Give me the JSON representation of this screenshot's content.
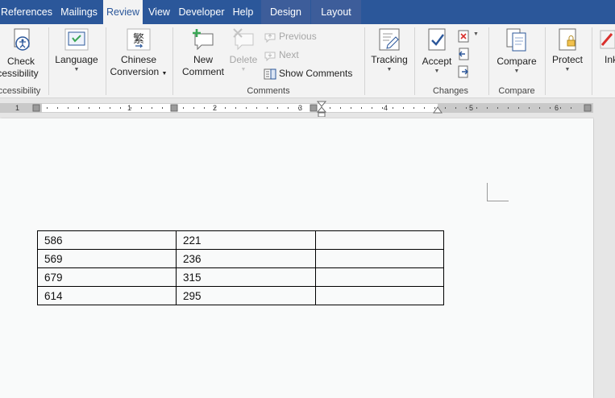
{
  "tabs": [
    {
      "label": "References",
      "active": false
    },
    {
      "label": "Mailings",
      "active": false
    },
    {
      "label": "Review",
      "active": true
    },
    {
      "label": "View",
      "active": false
    },
    {
      "label": "Developer",
      "active": false
    },
    {
      "label": "Help",
      "active": false
    },
    {
      "label": "Design",
      "active": false,
      "contextual": true
    },
    {
      "label": "Layout",
      "active": false,
      "contextual": true
    }
  ],
  "ribbon": {
    "accessibility": {
      "button_line1": "Check",
      "button_line2": "ccessibility",
      "group": "ccessibility"
    },
    "language": {
      "button": "Language"
    },
    "chinese": {
      "line1": "Chinese",
      "line2": "Conversion"
    },
    "comments": {
      "new_line1": "New",
      "new_line2": "Comment",
      "delete": "Delete",
      "previous": "Previous",
      "next": "Next",
      "show_comments": "Show Comments",
      "group": "Comments"
    },
    "tracking": {
      "button": "Tracking"
    },
    "changes": {
      "accept": "Accept",
      "group": "Changes"
    },
    "compare": {
      "button": "Compare",
      "group": "Compare"
    },
    "protect": {
      "button": "Protect"
    },
    "ink": {
      "button": "Ink"
    }
  },
  "ruler": {
    "numbers": [
      "1",
      "1",
      "2",
      "3",
      "4",
      "5",
      "6"
    ]
  },
  "table": {
    "rows": [
      [
        "586",
        "221",
        ""
      ],
      [
        "569",
        "236",
        ""
      ],
      [
        "679",
        "315",
        ""
      ],
      [
        "614",
        "295",
        ""
      ]
    ]
  },
  "colors": {
    "tab_bar": "#2b579a",
    "ribbon": "#f3f3f3",
    "page": "#f9fafa",
    "accent_green": "#3aa655"
  }
}
